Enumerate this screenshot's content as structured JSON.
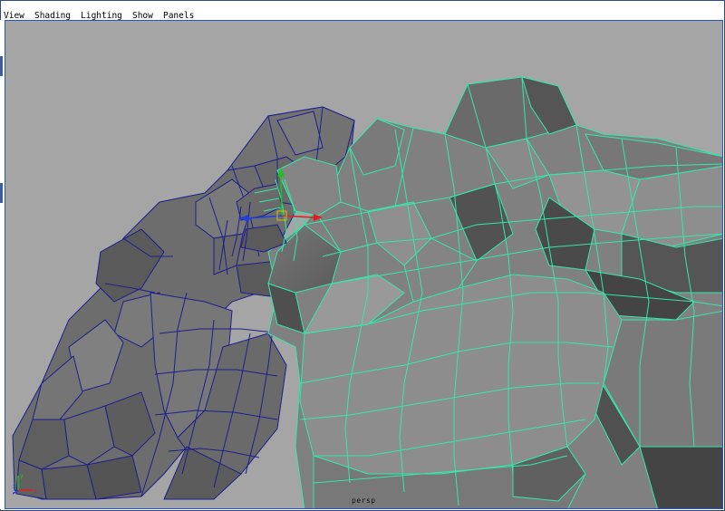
{
  "menubar": {
    "items": [
      {
        "label": "View"
      },
      {
        "label": "Shading"
      },
      {
        "label": "Lighting"
      },
      {
        "label": "Show"
      },
      {
        "label": "Panels"
      }
    ]
  },
  "viewport": {
    "camera_label": "persp",
    "background_color": "#a5a5a5",
    "selected_wire_color": "#33e8a8",
    "unselected_wire_color": "#1c1f8e"
  },
  "axis_gizmo": {
    "icon": "axis-indicator-icon",
    "x_color": "#e02020",
    "y_color": "#20c020",
    "z_color": "#2040e0"
  },
  "manipulator": {
    "icon": "move-manipulator-icon"
  }
}
